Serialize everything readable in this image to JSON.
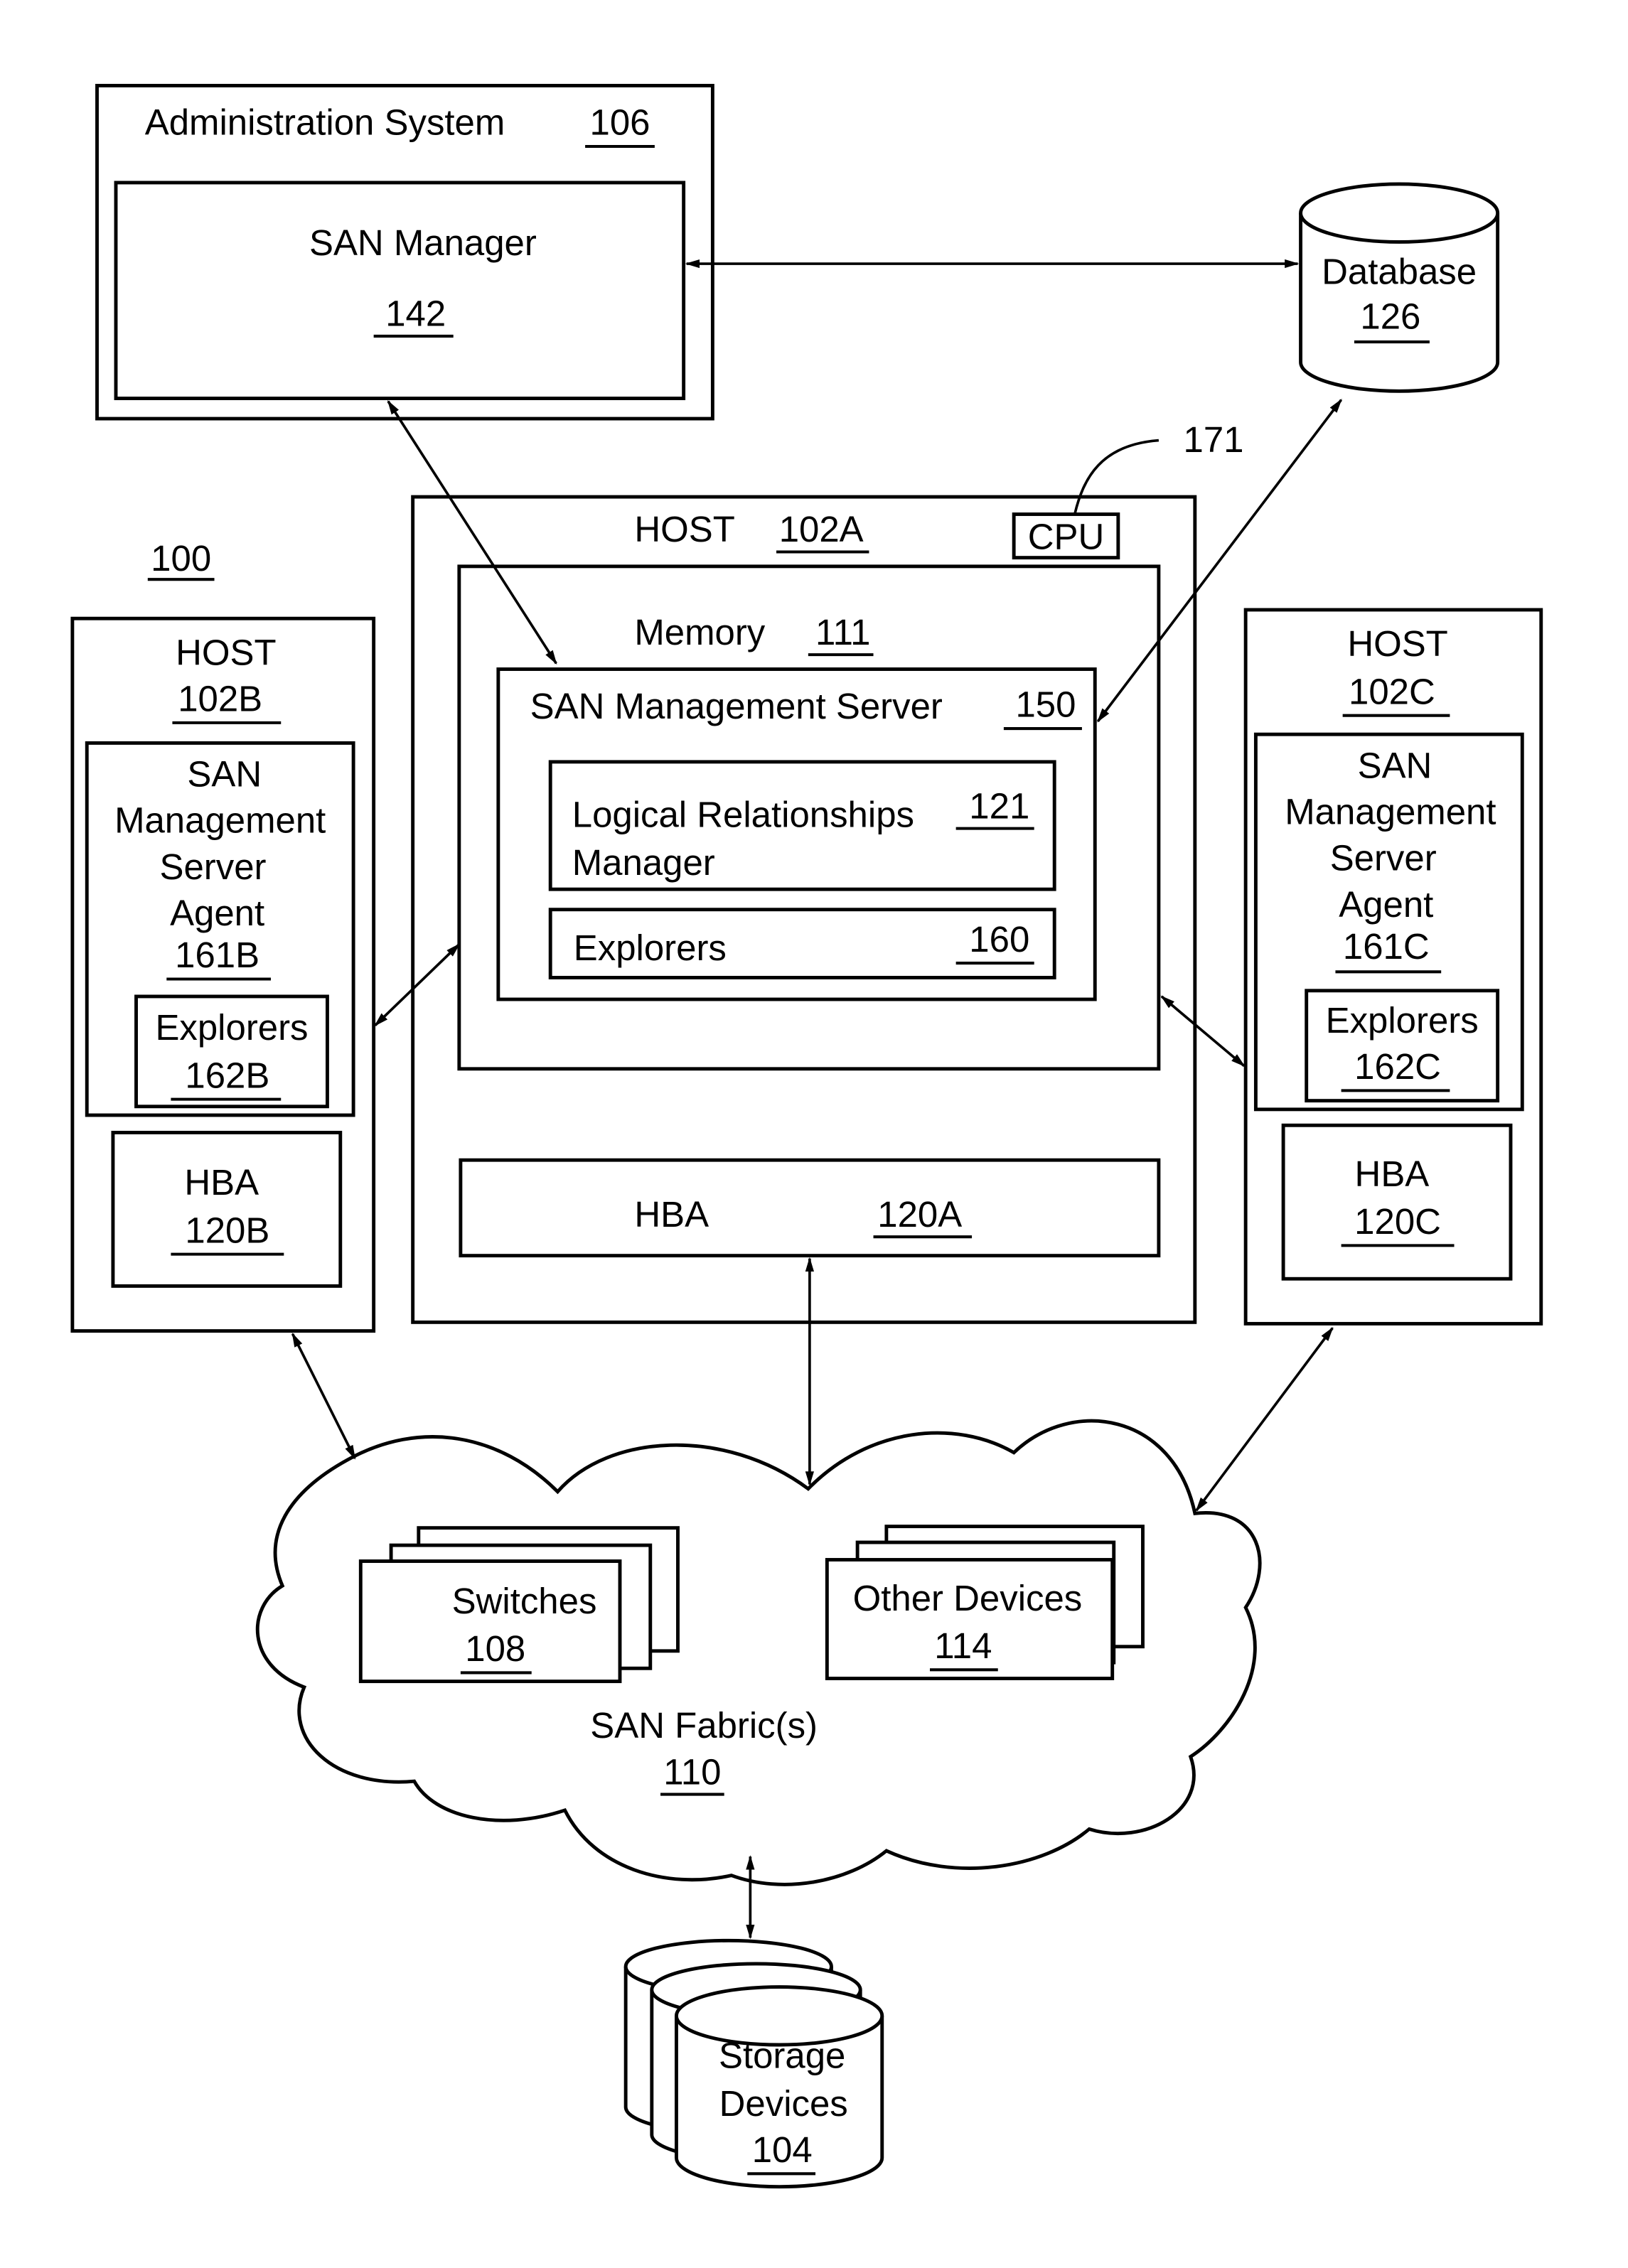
{
  "figure_ref": "100",
  "administration_system": {
    "title": "Administration System",
    "ref": "106"
  },
  "san_manager": {
    "title": "SAN Manager",
    "ref": "142"
  },
  "database": {
    "title": "Database",
    "ref": "126"
  },
  "cpu": {
    "label": "CPU",
    "ref": "171"
  },
  "host_a": {
    "title": "HOST",
    "ref": "102A",
    "memory": {
      "title": "Memory",
      "ref": "111"
    },
    "san_management_server": {
      "title": "SAN Management Server",
      "ref": "150"
    },
    "logical_relationships_manager": {
      "line1": "Logical Relationships",
      "line2": "Manager",
      "ref": "121"
    },
    "explorers": {
      "title": "Explorers",
      "ref": "160"
    },
    "hba": {
      "title": "HBA",
      "ref": "120A"
    }
  },
  "host_b": {
    "title": "HOST",
    "ref": "102B",
    "agent": {
      "lines": [
        "SAN",
        "Management",
        "Server",
        "Agent"
      ],
      "ref": "161B"
    },
    "explorers": {
      "title": "Explorers",
      "ref": "162B"
    },
    "hba": {
      "title": "HBA",
      "ref": "120B"
    }
  },
  "host_c": {
    "title": "HOST",
    "ref": "102C",
    "agent": {
      "lines": [
        "SAN",
        "Management",
        "Server",
        "Agent"
      ],
      "ref": "161C"
    },
    "explorers": {
      "title": "Explorers",
      "ref": "162C"
    },
    "hba": {
      "title": "HBA",
      "ref": "120C"
    }
  },
  "san_fabric": {
    "title": "SAN Fabric(s)",
    "ref": "110",
    "switches": {
      "title": "Switches",
      "ref": "108"
    },
    "other_devices": {
      "title": "Other Devices",
      "ref": "114"
    }
  },
  "storage_devices": {
    "line1": "Storage",
    "line2": "Devices",
    "ref": "104"
  }
}
